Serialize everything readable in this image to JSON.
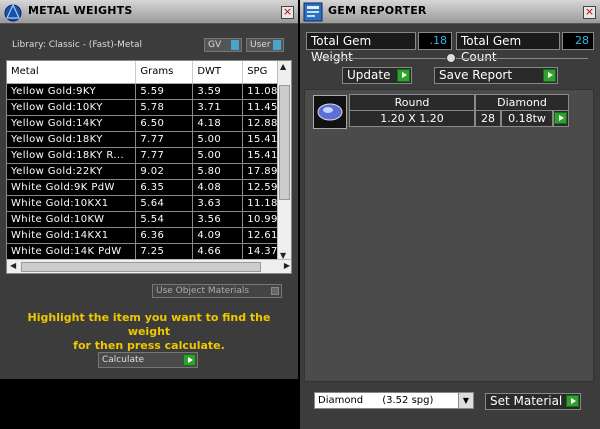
{
  "metal_panel": {
    "title": "METAL WEIGHTS",
    "library": "Library: Classic - (Fast)-Metal",
    "gv_label": "GV",
    "user_label": "User",
    "columns": [
      "Metal",
      "Grams",
      "DWT",
      "SPG"
    ],
    "rows": [
      [
        "Yellow Gold:9KY",
        "5.59",
        "3.59",
        "11.08"
      ],
      [
        "Yellow Gold:10KY",
        "5.78",
        "3.71",
        "11.45"
      ],
      [
        "Yellow Gold:14KY",
        "6.50",
        "4.18",
        "12.88"
      ],
      [
        "Yellow Gold:18KY",
        "7.77",
        "5.00",
        "15.41"
      ],
      [
        "Yellow Gold:18KY R...",
        "7.77",
        "5.00",
        "15.41"
      ],
      [
        "Yellow Gold:22KY",
        "9.02",
        "5.80",
        "17.89"
      ],
      [
        "White Gold:9K PdW",
        "6.35",
        "4.08",
        "12.59"
      ],
      [
        "White Gold:10KX1",
        "5.64",
        "3.63",
        "11.18"
      ],
      [
        "White Gold:10KW",
        "5.54",
        "3.56",
        "10.99"
      ],
      [
        "White Gold:14KX1",
        "6.36",
        "4.09",
        "12.61"
      ],
      [
        "White Gold:14K PdW",
        "7.25",
        "4.66",
        "14.37"
      ]
    ],
    "use_object_materials": "Use Object Materials",
    "hint_line1": "Highlight the item you want to find the weight",
    "hint_line2": "for then press calculate.",
    "calculate_label": "Calculate"
  },
  "gem_panel": {
    "title": "GEM REPORTER",
    "total_weight_label": "Total Gem Weight",
    "total_weight_value": ".18",
    "total_count_label": "Total Gem Count",
    "total_count_value": "28",
    "update_label": "Update",
    "save_report_label": "Save Report",
    "gem_row": {
      "shape": "Round",
      "material": "Diamond",
      "size": "1.20 X 1.20",
      "count": "28",
      "weight": "0.18tw"
    },
    "material_select": "Diamond      (3.52 spg)",
    "set_material_label": "Set Material"
  },
  "colors": {
    "accent_blue": "#35b6e6",
    "hint_yellow": "#f0c800",
    "go_green": "#2ea12e"
  },
  "icons": [
    "app-logo-icon",
    "close-icon",
    "gem-reporter-icon",
    "round-gem-icon",
    "play-arrow-icon",
    "dropdown-arrow-icon"
  ]
}
